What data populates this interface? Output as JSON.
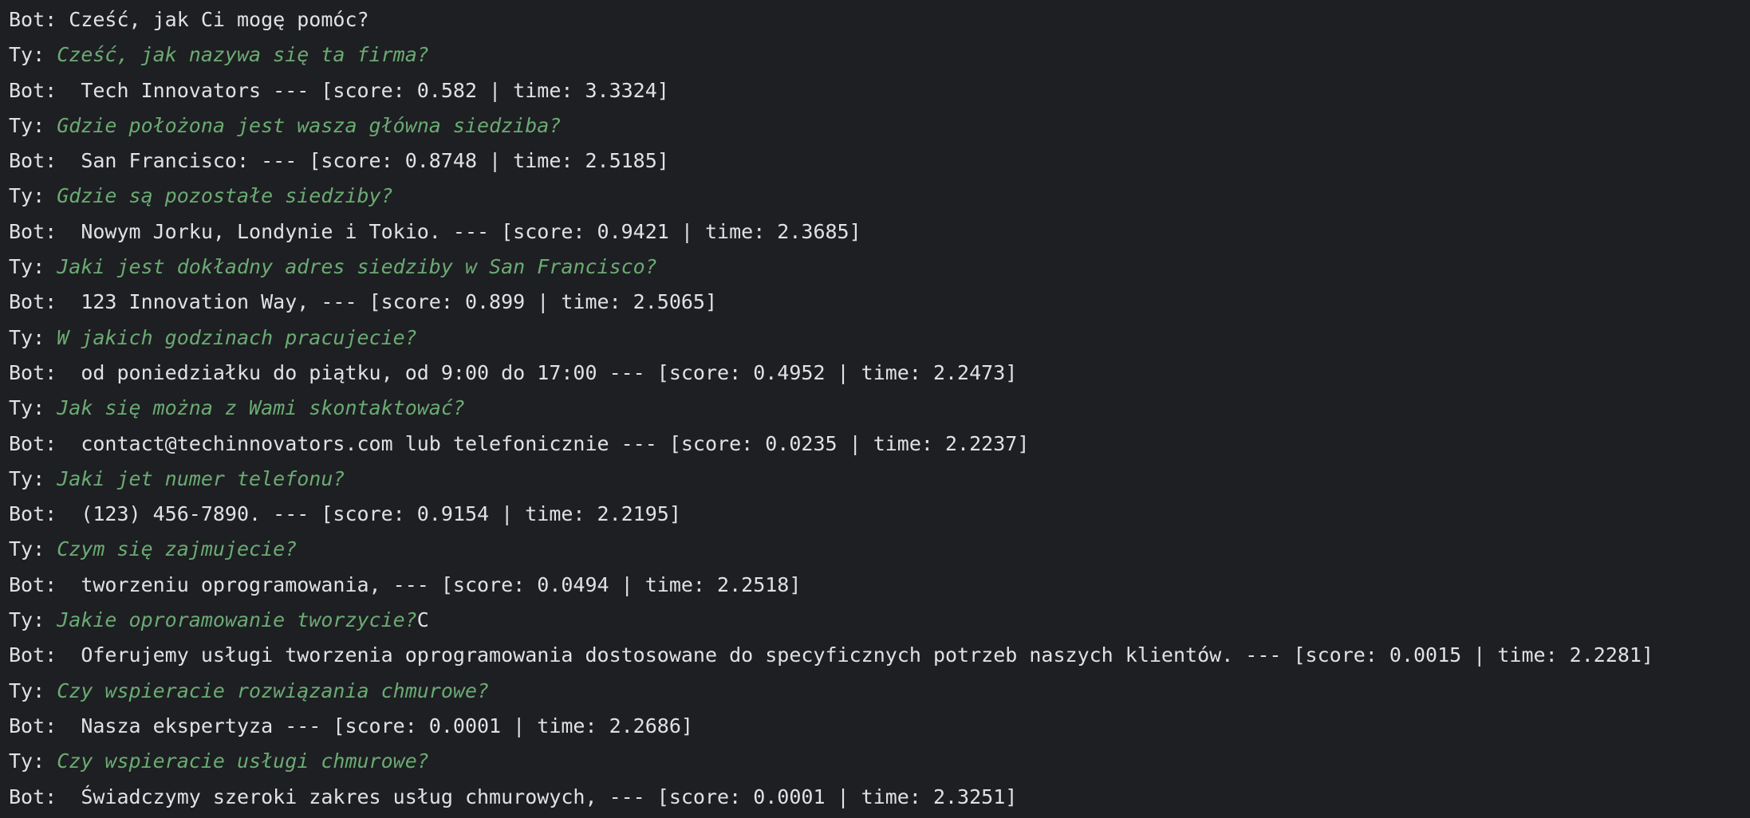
{
  "console": {
    "lines": [
      {
        "speaker": "Bot: ",
        "text": "Cześć, jak Ci mogę pomóc?"
      },
      {
        "speaker": "Ty: ",
        "text": "Cześć, jak nazywa się ta firma?"
      },
      {
        "speaker": "Bot: ",
        "text": " Tech Innovators --- [score: 0.582 | time: 3.3324]"
      },
      {
        "speaker": "Ty: ",
        "text": "Gdzie położona jest wasza główna siedziba?"
      },
      {
        "speaker": "Bot: ",
        "text": " San Francisco: --- [score: 0.8748 | time: 2.5185]"
      },
      {
        "speaker": "Ty: ",
        "text": "Gdzie są pozostałe siedziby?"
      },
      {
        "speaker": "Bot: ",
        "text": " Nowym Jorku, Londynie i Tokio. --- [score: 0.9421 | time: 2.3685]"
      },
      {
        "speaker": "Ty: ",
        "text": "Jaki jest dokładny adres siedziby w San Francisco?"
      },
      {
        "speaker": "Bot: ",
        "text": " 123 Innovation Way, --- [score: 0.899 | time: 2.5065]"
      },
      {
        "speaker": "Ty: ",
        "text": "W jakich godzinach pracujecie?"
      },
      {
        "speaker": "Bot: ",
        "text": " od poniedziałku do piątku, od 9:00 do 17:00 --- [score: 0.4952 | time: 2.2473]"
      },
      {
        "speaker": "Ty: ",
        "text": "Jak się można z Wami skontaktować?"
      },
      {
        "speaker": "Bot: ",
        "text": " contact@techinnovators.com lub telefonicznie --- [score: 0.0235 | time: 2.2237]"
      },
      {
        "speaker": "Ty: ",
        "text": "Jaki jet numer telefonu?"
      },
      {
        "speaker": "Bot: ",
        "text": " (123) 456-7890. --- [score: 0.9154 | time: 2.2195]"
      },
      {
        "speaker": "Ty: ",
        "text": "Czym się zajmujecie?"
      },
      {
        "speaker": "Bot: ",
        "text": " tworzeniu oprogramowania, --- [score: 0.0494 | time: 2.2518]"
      },
      {
        "speaker": "Ty: ",
        "text": "Jakie oproramowanie tworzycie?",
        "typed": "C"
      },
      {
        "speaker": "Bot: ",
        "text": " Oferujemy usługi tworzenia oprogramowania dostosowane do specyficznych potrzeb naszych klientów. --- [score: 0.0015 | time: 2.2281]"
      },
      {
        "speaker": "Ty: ",
        "text": "Czy wspieracie rozwiązania chmurowe?"
      },
      {
        "speaker": "Bot: ",
        "text": " Nasza ekspertyza --- [score: 0.0001 | time: 2.2686]"
      },
      {
        "speaker": "Ty: ",
        "text": "Czy wspieracie usługi chmurowe?"
      },
      {
        "speaker": "Bot: ",
        "text": " Świadczymy szeroki zakres usług chmurowych, --- [score: 0.0001 | time: 2.3251]"
      }
    ]
  }
}
